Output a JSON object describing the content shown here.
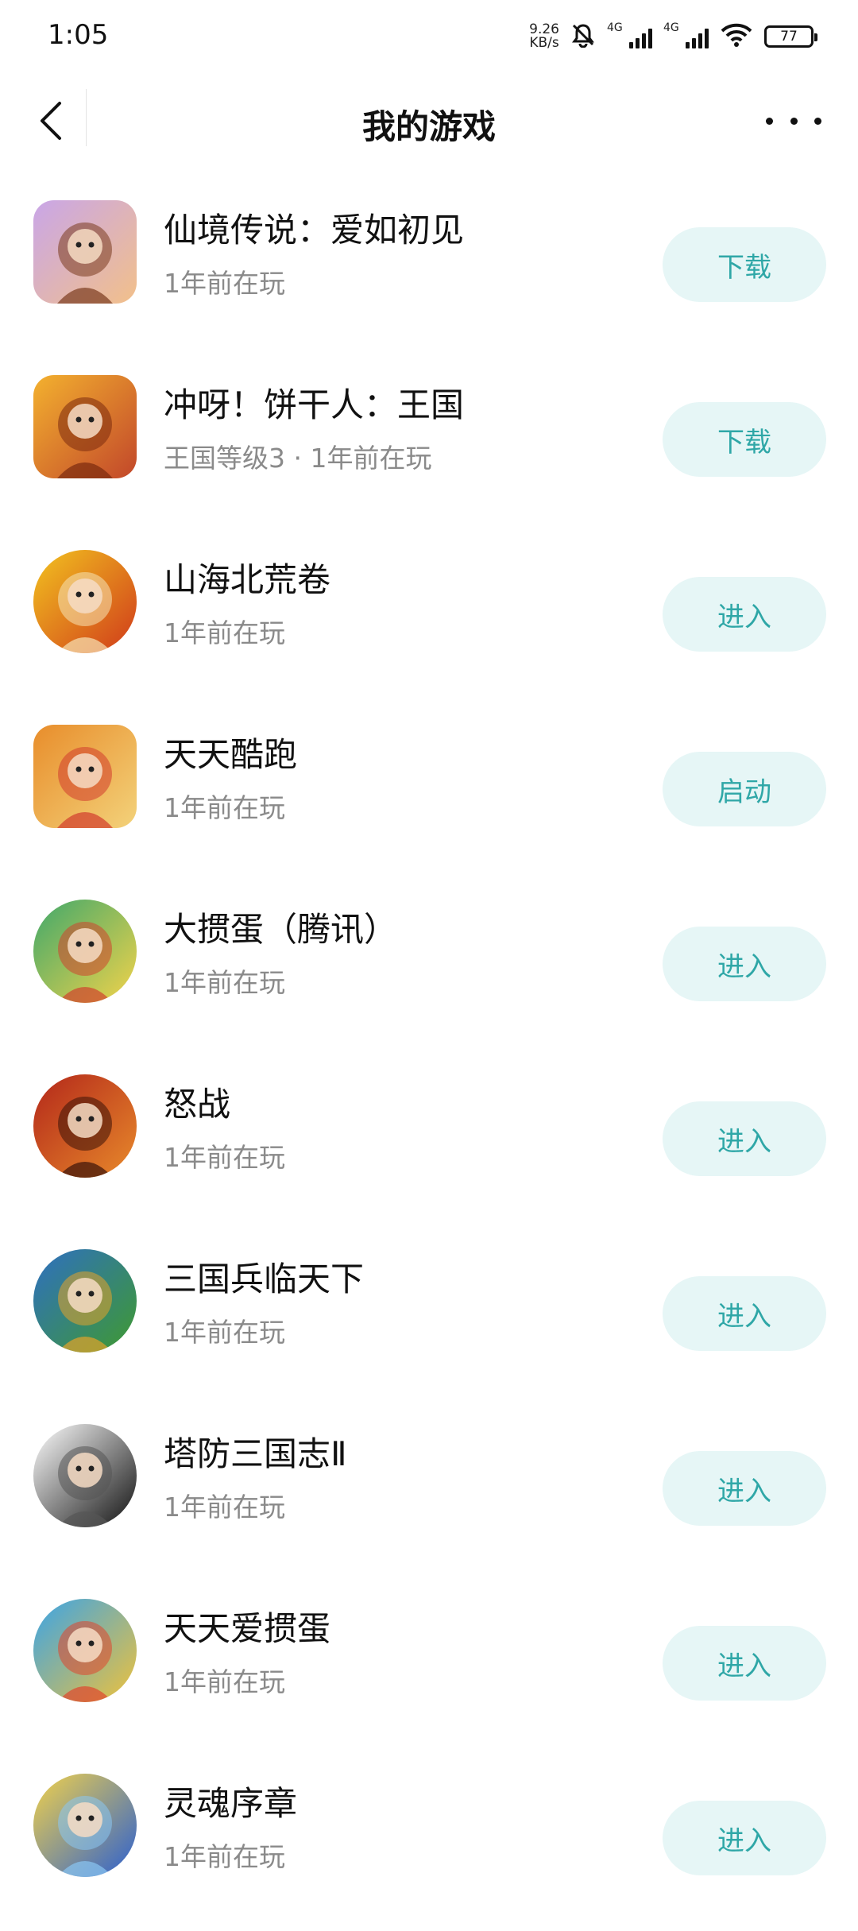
{
  "status_bar": {
    "time": "1:05",
    "net_speed_value": "9.26",
    "net_speed_unit": "KB/s",
    "signal1_tag": "4G",
    "signal2_tag": "4G",
    "battery": "77"
  },
  "header": {
    "title": "我的游戏"
  },
  "games": [
    {
      "name": "仙境传说：爱如初见",
      "sub": "1年前在玩",
      "action": "下载",
      "icon": "game-icon-ragnarok",
      "colors": [
        "#c9a6e8",
        "#f2c08a",
        "#7a3b1e"
      ]
    },
    {
      "name": "冲呀！饼干人：王国",
      "sub": "王国等级3  ·  1年前在玩",
      "action": "下载",
      "icon": "game-icon-cookie-run",
      "colors": [
        "#f3b12f",
        "#c2472a",
        "#7b2a0e"
      ]
    },
    {
      "name": "山海北荒卷",
      "sub": "1年前在玩",
      "action": "进入",
      "icon": "game-icon-shanhai",
      "colors": [
        "#f2c320",
        "#d03a1a",
        "#f6e3b5"
      ]
    },
    {
      "name": "天天酷跑",
      "sub": "1年前在玩",
      "action": "启动",
      "icon": "game-icon-tiantian-kupao",
      "colors": [
        "#e88d2b",
        "#f3d27a",
        "#d23c2e"
      ]
    },
    {
      "name": "大掼蛋（腾讯）",
      "sub": "1年前在玩",
      "action": "进入",
      "icon": "game-icon-guandan-tencent",
      "colors": [
        "#3fa86b",
        "#f3d34a",
        "#d0432e"
      ]
    },
    {
      "name": "怒战",
      "sub": "1年前在玩",
      "action": "进入",
      "icon": "game-icon-nuzhan",
      "colors": [
        "#b3271a",
        "#e88a2b",
        "#3a1208"
      ]
    },
    {
      "name": "三国兵临天下",
      "sub": "1年前在玩",
      "action": "进入",
      "icon": "game-icon-sanguo-binglin",
      "colors": [
        "#2e6fc2",
        "#3f9a2f",
        "#e3a22a"
      ]
    },
    {
      "name": "塔防三国志Ⅱ",
      "sub": "1年前在玩",
      "action": "进入",
      "icon": "game-icon-tafang-sanguo",
      "colors": [
        "#ffffff",
        "#111111",
        "#555555"
      ]
    },
    {
      "name": "天天爱掼蛋",
      "sub": "1年前在玩",
      "action": "进入",
      "icon": "game-icon-tiantian-guandan",
      "colors": [
        "#3aa4e8",
        "#f0c23a",
        "#e0462e"
      ]
    },
    {
      "name": "灵魂序章",
      "sub": "1年前在玩",
      "action": "进入",
      "icon": "game-icon-linghun-xuzhang",
      "colors": [
        "#f2d24a",
        "#2b5fd0",
        "#8ac6f2"
      ]
    }
  ],
  "colors": {
    "button_bg": "#e6f6f6",
    "button_text": "#2fa7a7",
    "subtext": "#8a8a8a"
  }
}
